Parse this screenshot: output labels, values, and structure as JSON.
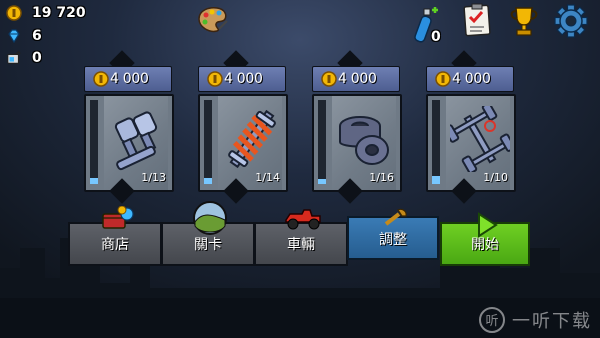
{
  "stats": {
    "coins": "19 720",
    "gems": "6",
    "fuel": "0"
  },
  "top_bar": {
    "fuel_can_count": "0",
    "icons": [
      "paint-palette-icon",
      "fuel-can-icon",
      "checklist-icon",
      "trophy-icon",
      "gear-icon"
    ]
  },
  "upgrades": [
    {
      "part": "engine",
      "price": "4 000",
      "level": "1/13",
      "level_fraction": 0.077
    },
    {
      "part": "suspension",
      "price": "4 000",
      "level": "1/14",
      "level_fraction": 0.071
    },
    {
      "part": "tires",
      "price": "4 000",
      "level": "1/16",
      "level_fraction": 0.0625
    },
    {
      "part": "4wd",
      "price": "4 000",
      "level": "1/10",
      "level_fraction": 0.1
    }
  ],
  "nav": {
    "shop": "商店",
    "stages": "關卡",
    "vehicles": "車輛",
    "tuning": "調整",
    "start": "開始"
  },
  "watermark": {
    "text": "一听下载",
    "logo": "听"
  },
  "colors": {
    "coin": "#f2b705",
    "gem": "#3fb8ff",
    "price_bar": "#5d6ea3",
    "nav_active": "#2f6da3",
    "start": "#5bbd1a"
  }
}
